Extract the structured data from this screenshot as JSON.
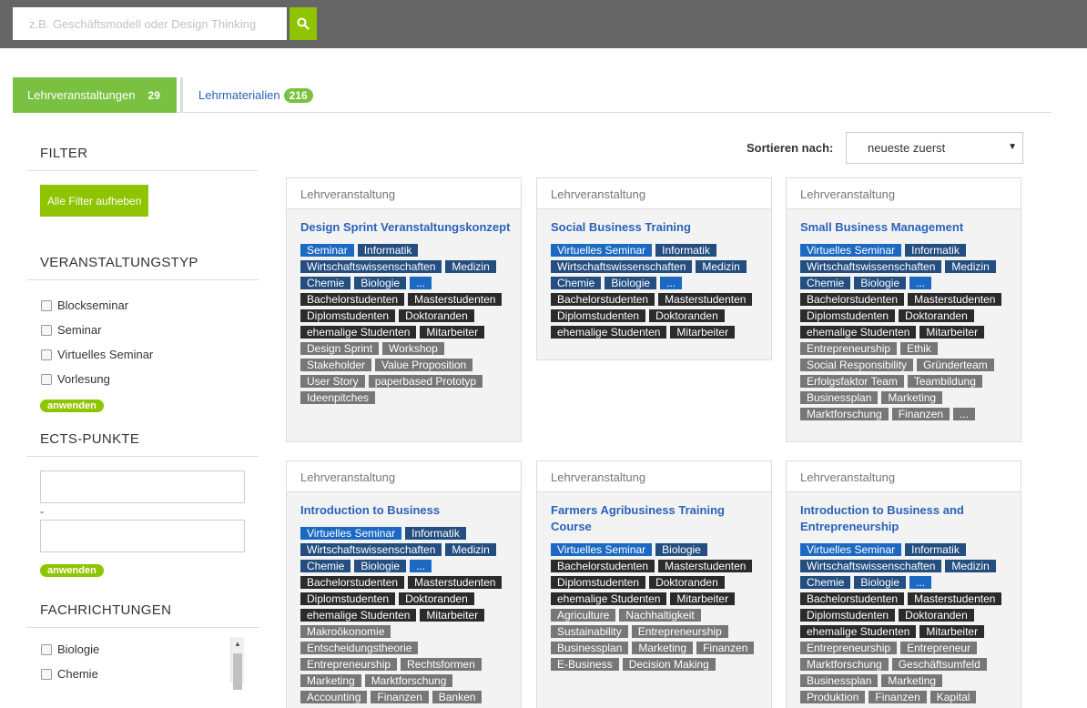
{
  "search": {
    "placeholder": "z.B. Geschäftsmodell oder Design Thinking"
  },
  "tabs": {
    "active": {
      "label": "Lehrveranstaltungen",
      "count": "29"
    },
    "inactive": {
      "label": "Lehrmaterialien",
      "count": "216"
    }
  },
  "sidebar": {
    "filter_heading": "FILTER",
    "clear_button": "Alle Filter aufheben",
    "type_heading": "VERANSTALTUNGSTYP",
    "types": [
      "Blockseminar",
      "Seminar",
      "Virtuelles Seminar",
      "Vorlesung"
    ],
    "apply": "anwenden",
    "ects_heading": "ECTS-PUNKTE",
    "ects_sep": "-",
    "field_heading": "FACHRICHTUNGEN",
    "fields": [
      "Biologie",
      "Chemie"
    ]
  },
  "sort": {
    "label": "Sortieren nach:",
    "value": "neueste zuerst"
  },
  "cards": [
    {
      "type": "Lehrveranstaltung",
      "title": "Design Sprint Veranstaltungskonzept",
      "tags": [
        {
          "t": "Seminar",
          "c": "blue"
        },
        {
          "t": "Informatik",
          "c": "navy"
        },
        {
          "t": "Wirtschaftswissenschaften",
          "c": "navy"
        },
        {
          "t": "Medizin",
          "c": "navy"
        },
        {
          "t": "Chemie",
          "c": "navy"
        },
        {
          "t": "Biologie",
          "c": "navy"
        },
        {
          "t": "...",
          "c": "blue"
        },
        {
          "t": "Bachelorstudenten",
          "c": "black"
        },
        {
          "t": "Masterstudenten",
          "c": "black"
        },
        {
          "t": "Diplomstudenten",
          "c": "black"
        },
        {
          "t": "Doktoranden",
          "c": "black"
        },
        {
          "t": "ehemalige Studenten",
          "c": "black"
        },
        {
          "t": "Mitarbeiter",
          "c": "black"
        },
        {
          "t": "Design Sprint",
          "c": "gray"
        },
        {
          "t": "Workshop",
          "c": "gray"
        },
        {
          "t": "Stakeholder",
          "c": "gray"
        },
        {
          "t": "Value Proposition",
          "c": "gray"
        },
        {
          "t": "User Story",
          "c": "gray"
        },
        {
          "t": "paperbased Prototyp",
          "c": "gray"
        },
        {
          "t": "Ideenpitches",
          "c": "gray"
        }
      ]
    },
    {
      "type": "Lehrveranstaltung",
      "title": "Social Business Training",
      "tags": [
        {
          "t": "Virtuelles Seminar",
          "c": "blue"
        },
        {
          "t": "Informatik",
          "c": "navy"
        },
        {
          "t": "Wirtschaftswissenschaften",
          "c": "navy"
        },
        {
          "t": "Medizin",
          "c": "navy"
        },
        {
          "t": "Chemie",
          "c": "navy"
        },
        {
          "t": "Biologie",
          "c": "navy"
        },
        {
          "t": "...",
          "c": "blue"
        },
        {
          "t": "Bachelorstudenten",
          "c": "black"
        },
        {
          "t": "Masterstudenten",
          "c": "black"
        },
        {
          "t": "Diplomstudenten",
          "c": "black"
        },
        {
          "t": "Doktoranden",
          "c": "black"
        },
        {
          "t": "ehemalige Studenten",
          "c": "black"
        },
        {
          "t": "Mitarbeiter",
          "c": "black"
        }
      ]
    },
    {
      "type": "Lehrveranstaltung",
      "title": "Small Business Management",
      "tags": [
        {
          "t": "Virtuelles Seminar",
          "c": "blue"
        },
        {
          "t": "Informatik",
          "c": "navy"
        },
        {
          "t": "Wirtschaftswissenschaften",
          "c": "navy"
        },
        {
          "t": "Medizin",
          "c": "navy"
        },
        {
          "t": "Chemie",
          "c": "navy"
        },
        {
          "t": "Biologie",
          "c": "navy"
        },
        {
          "t": "...",
          "c": "blue"
        },
        {
          "t": "Bachelorstudenten",
          "c": "black"
        },
        {
          "t": "Masterstudenten",
          "c": "black"
        },
        {
          "t": "Diplomstudenten",
          "c": "black"
        },
        {
          "t": "Doktoranden",
          "c": "black"
        },
        {
          "t": "ehemalige Studenten",
          "c": "black"
        },
        {
          "t": "Mitarbeiter",
          "c": "black"
        },
        {
          "t": "Entrepreneurship",
          "c": "gray"
        },
        {
          "t": "Ethik",
          "c": "gray"
        },
        {
          "t": "Social Responsibility",
          "c": "gray"
        },
        {
          "t": "Gründerteam",
          "c": "gray"
        },
        {
          "t": "Erfolgsfaktor Team",
          "c": "gray"
        },
        {
          "t": "Teambildung",
          "c": "gray"
        },
        {
          "t": "Businessplan",
          "c": "gray"
        },
        {
          "t": "Marketing",
          "c": "gray"
        },
        {
          "t": "Marktforschung",
          "c": "gray"
        },
        {
          "t": "Finanzen",
          "c": "gray"
        },
        {
          "t": "...",
          "c": "gray"
        }
      ]
    },
    {
      "type": "Lehrveranstaltung",
      "title": "Introduction to Business",
      "tags": [
        {
          "t": "Virtuelles Seminar",
          "c": "blue"
        },
        {
          "t": "Informatik",
          "c": "navy"
        },
        {
          "t": "Wirtschaftswissenschaften",
          "c": "navy"
        },
        {
          "t": "Medizin",
          "c": "navy"
        },
        {
          "t": "Chemie",
          "c": "navy"
        },
        {
          "t": "Biologie",
          "c": "navy"
        },
        {
          "t": "...",
          "c": "blue"
        },
        {
          "t": "Bachelorstudenten",
          "c": "black"
        },
        {
          "t": "Masterstudenten",
          "c": "black"
        },
        {
          "t": "Diplomstudenten",
          "c": "black"
        },
        {
          "t": "Doktoranden",
          "c": "black"
        },
        {
          "t": "ehemalige Studenten",
          "c": "black"
        },
        {
          "t": "Mitarbeiter",
          "c": "black"
        },
        {
          "t": "Makroökonomie",
          "c": "gray"
        },
        {
          "t": "Entscheidungstheorie",
          "c": "gray"
        },
        {
          "t": "Entrepreneurship",
          "c": "gray"
        },
        {
          "t": "Rechtsformen",
          "c": "gray"
        },
        {
          "t": "Marketing",
          "c": "gray"
        },
        {
          "t": "Marktforschung",
          "c": "gray"
        },
        {
          "t": "Accounting",
          "c": "gray"
        },
        {
          "t": "Finanzen",
          "c": "gray"
        },
        {
          "t": "Banken",
          "c": "gray"
        }
      ]
    },
    {
      "type": "Lehrveranstaltung",
      "title": "Farmers Agribusiness Training Course",
      "tags": [
        {
          "t": "Virtuelles Seminar",
          "c": "blue"
        },
        {
          "t": "Biologie",
          "c": "navy"
        },
        {
          "t": "Bachelorstudenten",
          "c": "black"
        },
        {
          "t": "Masterstudenten",
          "c": "black"
        },
        {
          "t": "Diplomstudenten",
          "c": "black"
        },
        {
          "t": "Doktoranden",
          "c": "black"
        },
        {
          "t": "ehemalige Studenten",
          "c": "black"
        },
        {
          "t": "Mitarbeiter",
          "c": "black"
        },
        {
          "t": "Agriculture",
          "c": "gray"
        },
        {
          "t": "Nachhaltigkeit",
          "c": "gray"
        },
        {
          "t": "Sustainability",
          "c": "gray"
        },
        {
          "t": "Entrepreneurship",
          "c": "gray"
        },
        {
          "t": "Businessplan",
          "c": "gray"
        },
        {
          "t": "Marketing",
          "c": "gray"
        },
        {
          "t": "Finanzen",
          "c": "gray"
        },
        {
          "t": "E-Business",
          "c": "gray"
        },
        {
          "t": "Decision Making",
          "c": "gray"
        }
      ]
    },
    {
      "type": "Lehrveranstaltung",
      "title": "Introduction to Business and Entrepreneurship",
      "tags": [
        {
          "t": "Virtuelles Seminar",
          "c": "blue"
        },
        {
          "t": "Informatik",
          "c": "navy"
        },
        {
          "t": "Wirtschaftswissenschaften",
          "c": "navy"
        },
        {
          "t": "Medizin",
          "c": "navy"
        },
        {
          "t": "Chemie",
          "c": "navy"
        },
        {
          "t": "Biologie",
          "c": "navy"
        },
        {
          "t": "...",
          "c": "blue"
        },
        {
          "t": "Bachelorstudenten",
          "c": "black"
        },
        {
          "t": "Masterstudenten",
          "c": "black"
        },
        {
          "t": "Diplomstudenten",
          "c": "black"
        },
        {
          "t": "Doktoranden",
          "c": "black"
        },
        {
          "t": "ehemalige Studenten",
          "c": "black"
        },
        {
          "t": "Mitarbeiter",
          "c": "black"
        },
        {
          "t": "Entrepreneurship",
          "c": "gray"
        },
        {
          "t": "Entrepreneur",
          "c": "gray"
        },
        {
          "t": "Marktforschung",
          "c": "gray"
        },
        {
          "t": "Geschäftsumfeld",
          "c": "gray"
        },
        {
          "t": "Businessplan",
          "c": "gray"
        },
        {
          "t": "Marketing",
          "c": "gray"
        },
        {
          "t": "Produktion",
          "c": "gray"
        },
        {
          "t": "Finanzen",
          "c": "gray"
        },
        {
          "t": "Kapital",
          "c": "gray"
        }
      ]
    }
  ]
}
